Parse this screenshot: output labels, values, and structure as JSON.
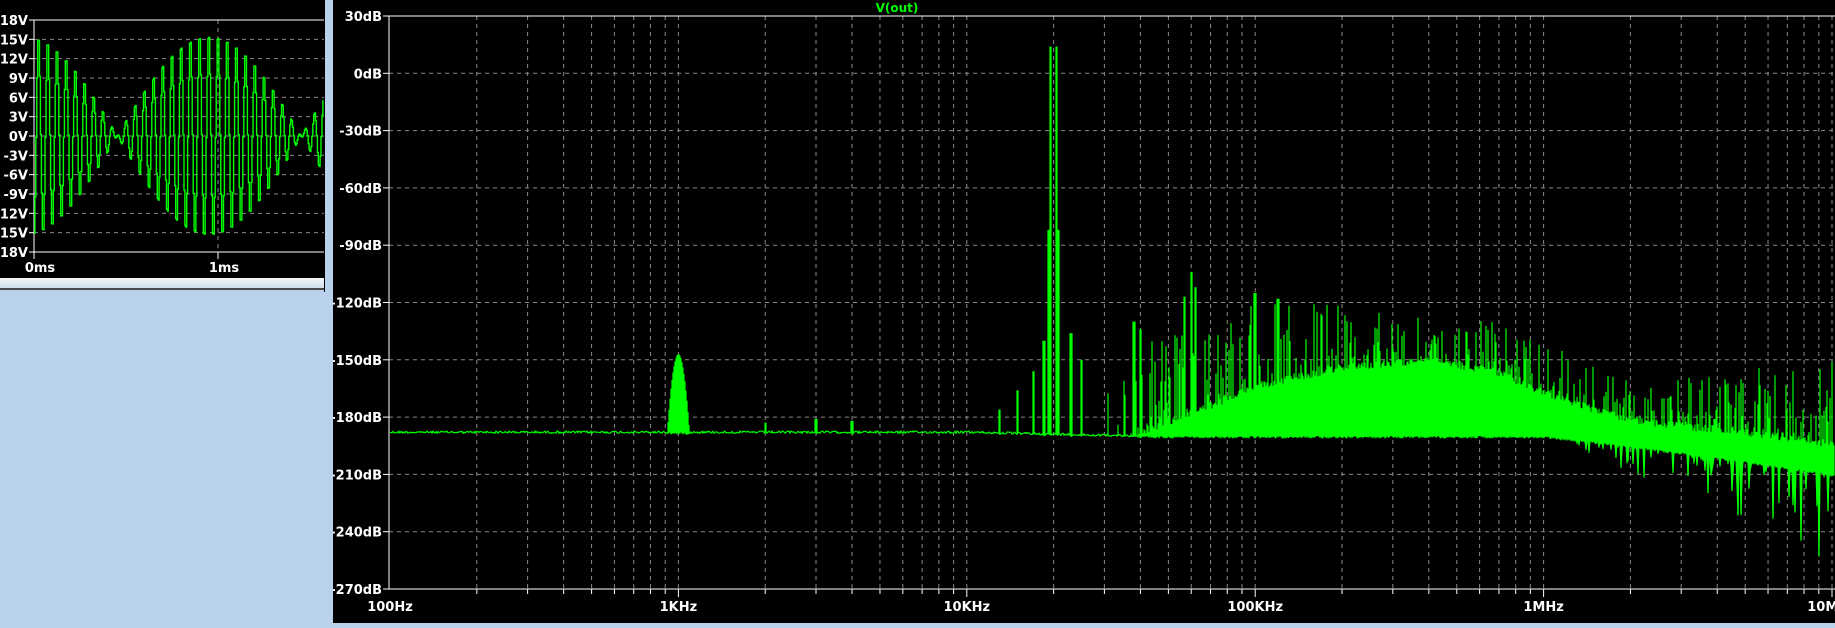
{
  "colors": {
    "trace": "#00ff00",
    "background": "#000000",
    "grid": "#8a8a8a",
    "axis": "#ffffff",
    "window": "#b9d1ea"
  },
  "chart_data": [
    {
      "type": "line",
      "title": "",
      "xlabel": "",
      "ylabel": "",
      "xlim_ms": [
        0,
        1.57
      ],
      "ylim": [
        -18,
        18
      ],
      "grid": true,
      "x_ticks": [
        "0ms",
        "1ms"
      ],
      "x_tick_values": [
        0,
        1
      ],
      "y_ticks": [
        "18V",
        "15V",
        "12V",
        "9V",
        "6V",
        "3V",
        "0V",
        "-3V",
        "-6V",
        "-9V",
        "-12V",
        "-15V",
        "-18V"
      ],
      "y_tick_values": [
        18,
        15,
        12,
        9,
        6,
        3,
        0,
        -3,
        -6,
        -9,
        -12,
        -15,
        -18
      ],
      "signal": {
        "amplitude_v": 16,
        "carrier_hz": 20000,
        "envelope_null_ms": 0.45,
        "envelope_period_ms": 1.0
      }
    },
    {
      "type": "line",
      "title": "V(out)",
      "xlabel": "",
      "ylabel": "",
      "x_scale": "log",
      "xlim": [
        100,
        10000000
      ],
      "ylim": [
        -270,
        30
      ],
      "grid": true,
      "x_ticks": [
        "100Hz",
        "1KHz",
        "10KHz",
        "100KHz",
        "1MHz",
        "10MHz"
      ],
      "x_tick_values": [
        100,
        1000,
        10000,
        100000,
        1000000,
        10000000
      ],
      "y_ticks": [
        "30dB",
        "0dB",
        "-30dB",
        "-60dB",
        "-90dB",
        "-120dB",
        "-150dB",
        "-180dB",
        "-210dB",
        "-240dB",
        "-270dB"
      ],
      "y_tick_values": [
        30,
        0,
        -30,
        -60,
        -90,
        -120,
        -150,
        -180,
        -210,
        -240,
        -270
      ],
      "noise_floor": [
        [
          100,
          -188
        ],
        [
          1000,
          -188
        ],
        [
          10000,
          -188
        ],
        [
          40000,
          -190
        ],
        [
          1000000,
          -190
        ],
        [
          2000000,
          -195
        ],
        [
          5000000,
          -203
        ],
        [
          10000000,
          -210
        ]
      ],
      "noise_band_top": [
        [
          40000,
          -186
        ],
        [
          70000,
          -172
        ],
        [
          100000,
          -162
        ],
        [
          200000,
          -152
        ],
        [
          400000,
          -148
        ],
        [
          700000,
          -155
        ],
        [
          1000000,
          -165
        ],
        [
          2000000,
          -180
        ],
        [
          5000000,
          -186
        ],
        [
          10000000,
          -192
        ]
      ],
      "spur_envelope": [
        [
          30000,
          -150
        ],
        [
          100000,
          -118
        ],
        [
          300000,
          -120
        ],
        [
          600000,
          -125
        ],
        [
          1000000,
          -140
        ],
        [
          2000000,
          -160
        ],
        [
          5000000,
          -155
        ],
        [
          10000000,
          -150
        ]
      ],
      "peaks": [
        {
          "f": 1000,
          "db": -147
        },
        {
          "f": 2000,
          "db": -183
        },
        {
          "f": 3000,
          "db": -181
        },
        {
          "f": 4000,
          "db": -182
        },
        {
          "f": 13000,
          "db": -176
        },
        {
          "f": 15000,
          "db": -166
        },
        {
          "f": 17000,
          "db": -156
        },
        {
          "f": 18500,
          "db": -140
        },
        {
          "f": 19300,
          "db": -82
        },
        {
          "f": 19500,
          "db": 14
        },
        {
          "f": 20500,
          "db": 14
        },
        {
          "f": 20700,
          "db": -82
        },
        {
          "f": 23000,
          "db": -136
        },
        {
          "f": 25000,
          "db": -150
        },
        {
          "f": 38000,
          "db": -130
        },
        {
          "f": 40000,
          "db": -134
        },
        {
          "f": 57000,
          "db": -117
        },
        {
          "f": 60000,
          "db": -104
        },
        {
          "f": 62000,
          "db": -112
        },
        {
          "f": 100000,
          "db": -115
        },
        {
          "f": 120000,
          "db": -118
        }
      ]
    }
  ]
}
